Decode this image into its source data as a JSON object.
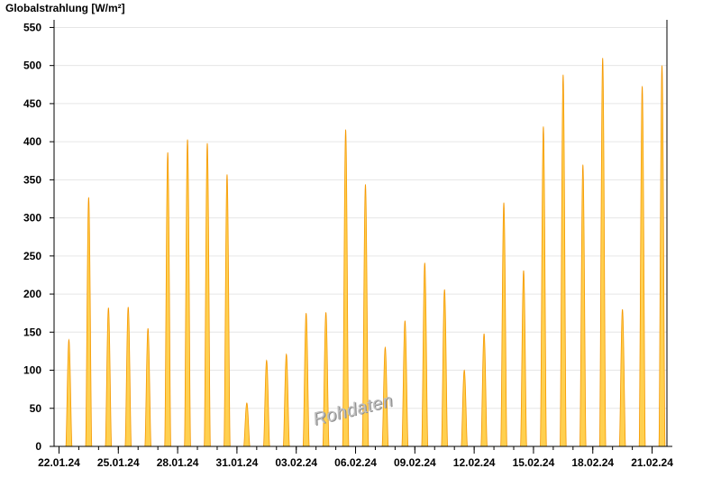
{
  "chart_data": {
    "type": "area",
    "title": "Globalstrahlung [W/m²]",
    "watermark": "Rohdaten",
    "ylim": [
      0,
      560
    ],
    "yticks": [
      0,
      50,
      100,
      150,
      200,
      250,
      300,
      350,
      400,
      450,
      500,
      550
    ],
    "grid": true,
    "x_range": [
      "2024-01-21T18:00",
      "2024-02-21T18:00"
    ],
    "xticks": [
      "22.01.24",
      "25.01.24",
      "28.01.24",
      "31.01.24",
      "03.02.24",
      "06.02.24",
      "09.02.24",
      "12.02.24",
      "15.02.24",
      "18.02.24",
      "21.02.24"
    ],
    "colors": {
      "fill": "#ffd050",
      "stroke": "#f59800"
    },
    "daily_peaks": [
      {
        "date": "2024-01-22",
        "value": 140
      },
      {
        "date": "2024-01-23",
        "value": 327
      },
      {
        "date": "2024-01-24",
        "value": 182
      },
      {
        "date": "2024-01-25",
        "value": 183
      },
      {
        "date": "2024-01-26",
        "value": 155
      },
      {
        "date": "2024-01-27",
        "value": 386
      },
      {
        "date": "2024-01-28",
        "value": 403
      },
      {
        "date": "2024-01-29",
        "value": 398
      },
      {
        "date": "2024-01-30",
        "value": 357
      },
      {
        "date": "2024-01-31",
        "value": 57
      },
      {
        "date": "2024-02-01",
        "value": 113
      },
      {
        "date": "2024-02-02",
        "value": 121
      },
      {
        "date": "2024-02-03",
        "value": 175
      },
      {
        "date": "2024-02-04",
        "value": 176
      },
      {
        "date": "2024-02-05",
        "value": 416
      },
      {
        "date": "2024-02-06",
        "value": 344
      },
      {
        "date": "2024-02-07",
        "value": 130
      },
      {
        "date": "2024-02-08",
        "value": 165
      },
      {
        "date": "2024-02-09",
        "value": 241
      },
      {
        "date": "2024-02-10",
        "value": 206
      },
      {
        "date": "2024-02-11",
        "value": 100
      },
      {
        "date": "2024-02-12",
        "value": 148
      },
      {
        "date": "2024-02-13",
        "value": 320
      },
      {
        "date": "2024-02-14",
        "value": 231
      },
      {
        "date": "2024-02-15",
        "value": 420
      },
      {
        "date": "2024-02-16",
        "value": 488
      },
      {
        "date": "2024-02-17",
        "value": 370
      },
      {
        "date": "2024-02-18",
        "value": 510
      },
      {
        "date": "2024-02-19",
        "value": 180
      },
      {
        "date": "2024-02-20",
        "value": 473
      },
      {
        "date": "2024-02-21",
        "value": 500
      }
    ]
  }
}
